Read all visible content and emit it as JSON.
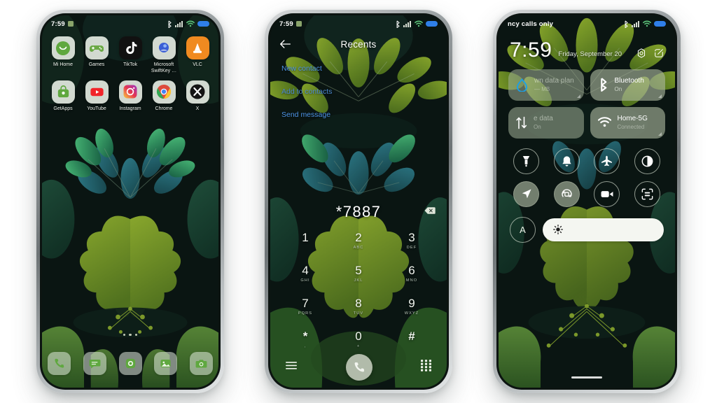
{
  "statusbar": {
    "time": "7:59",
    "alarm_icon": "alarm-chip-icon",
    "bluetooth_icon": "bluetooth-icon",
    "signal_icon": "signal-bars-icon",
    "wifi_icon": "wifi-icon",
    "battery_icon": "battery-icon",
    "carrier_text": "ncy calls only"
  },
  "home": {
    "apps_row1": [
      {
        "label": "Mi Home",
        "icon": "mi-home-icon"
      },
      {
        "label": "Games",
        "icon": "games-icon"
      },
      {
        "label": "TikTok",
        "icon": "tiktok-icon"
      },
      {
        "label": "Microsoft SwiftKey …",
        "icon": "swiftkey-icon"
      },
      {
        "label": "VLC",
        "icon": "vlc-icon"
      }
    ],
    "apps_row2": [
      {
        "label": "GetApps",
        "icon": "getapps-icon"
      },
      {
        "label": "YouTube",
        "icon": "youtube-icon"
      },
      {
        "label": "Instagram",
        "icon": "instagram-icon"
      },
      {
        "label": "Chrome",
        "icon": "chrome-icon"
      },
      {
        "label": "X",
        "icon": "x-icon"
      }
    ],
    "dock": [
      {
        "name": "phone",
        "icon": "phone-icon"
      },
      {
        "name": "messages",
        "icon": "messages-icon"
      },
      {
        "name": "browser",
        "icon": "browser-icon"
      },
      {
        "name": "gallery",
        "icon": "gallery-icon"
      },
      {
        "name": "camera",
        "icon": "camera-icon"
      }
    ],
    "page_dots": 3
  },
  "dialer": {
    "back_icon": "back-arrow-icon",
    "title": "Recents",
    "suggestions": [
      {
        "label": "New contact"
      },
      {
        "label": "Add to contacts"
      },
      {
        "label": "Send message"
      }
    ],
    "number": "*7887",
    "delete_icon": "backspace-icon",
    "keys": [
      {
        "digit": "1",
        "sub": " "
      },
      {
        "digit": "2",
        "sub": "ABC"
      },
      {
        "digit": "3",
        "sub": "DEF"
      },
      {
        "digit": "4",
        "sub": "GHI"
      },
      {
        "digit": "5",
        "sub": "JKL"
      },
      {
        "digit": "6",
        "sub": "MNO"
      },
      {
        "digit": "7",
        "sub": "PQRS"
      },
      {
        "digit": "8",
        "sub": "TUV"
      },
      {
        "digit": "9",
        "sub": "WXYZ"
      },
      {
        "digit": "*",
        "sub": ","
      },
      {
        "digit": "0",
        "sub": "+"
      },
      {
        "digit": "#",
        "sub": " "
      }
    ],
    "menu_icon": "menu-icon",
    "call_icon": "call-icon",
    "keypad_icon": "keypad-icon"
  },
  "quick_settings": {
    "time": "7:59",
    "date": "Friday, September 20",
    "settings_icon": "gear-icon",
    "edit_icon": "edit-icon",
    "tiles": [
      {
        "title": "wn data plan",
        "sub": "— MB",
        "icon": "data-plan-icon",
        "state": "muted"
      },
      {
        "title": "Bluetooth",
        "sub": "On",
        "icon": "bluetooth-icon",
        "state": "on"
      },
      {
        "title": "e data",
        "sub": "On",
        "icon": "mobile-data-icon",
        "state": "muted"
      },
      {
        "title": "Home-5G",
        "sub": "Connected",
        "icon": "wifi-icon",
        "state": "on"
      }
    ],
    "toggles": [
      {
        "icon": "flashlight-icon",
        "on": false
      },
      {
        "icon": "bell-icon",
        "on": false
      },
      {
        "icon": "airplane-icon",
        "on": false
      },
      {
        "icon": "contrast-icon",
        "on": false
      },
      {
        "icon": "location-icon",
        "on": true
      },
      {
        "icon": "auto-rotate-icon",
        "on": true
      },
      {
        "icon": "screen-recorder-icon",
        "on": false
      },
      {
        "icon": "qr-scan-icon",
        "on": false
      }
    ],
    "auto_brightness_label": "A",
    "brightness_icon": "sun-icon"
  },
  "colors": {
    "accent_blue": "#4d93e6",
    "battery_blue": "#2f7fe8",
    "tile_sage": "#acb8a0",
    "wall_dark": "#0a1512"
  }
}
